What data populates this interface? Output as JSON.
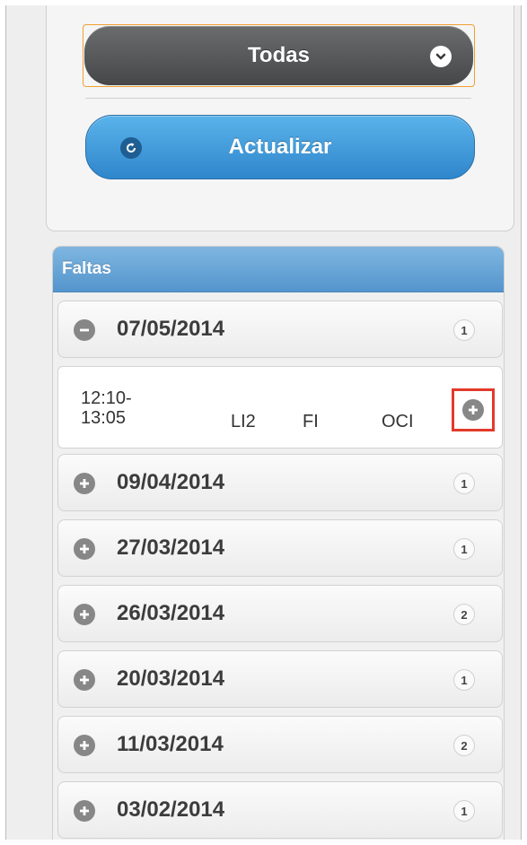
{
  "filter": {
    "selected_label": "Todas",
    "icon": "chevron-down-icon"
  },
  "refresh": {
    "label": "Actualizar",
    "icon": "refresh-icon"
  },
  "absences": {
    "title": "Faltas",
    "expanded_group": {
      "date": "07/05/2014",
      "count": "1",
      "icon": "minus-icon",
      "entries": [
        {
          "time": "12:10-13:05",
          "subject": "LI2",
          "type": "FI",
          "location": "OCI",
          "action_icon": "plus-icon"
        }
      ]
    },
    "groups": [
      {
        "date": "09/04/2014",
        "count": "1"
      },
      {
        "date": "27/03/2014",
        "count": "1"
      },
      {
        "date": "26/03/2014",
        "count": "2"
      },
      {
        "date": "20/03/2014",
        "count": "1"
      },
      {
        "date": "11/03/2014",
        "count": "2"
      },
      {
        "date": "03/02/2014",
        "count": "1"
      }
    ]
  },
  "colors": {
    "header_blue": "#5495cd",
    "button_blue": "#2f86cc",
    "select_dark": "#454749",
    "highlight_red": "#e23a2a",
    "focus_orange": "#f0a033"
  }
}
